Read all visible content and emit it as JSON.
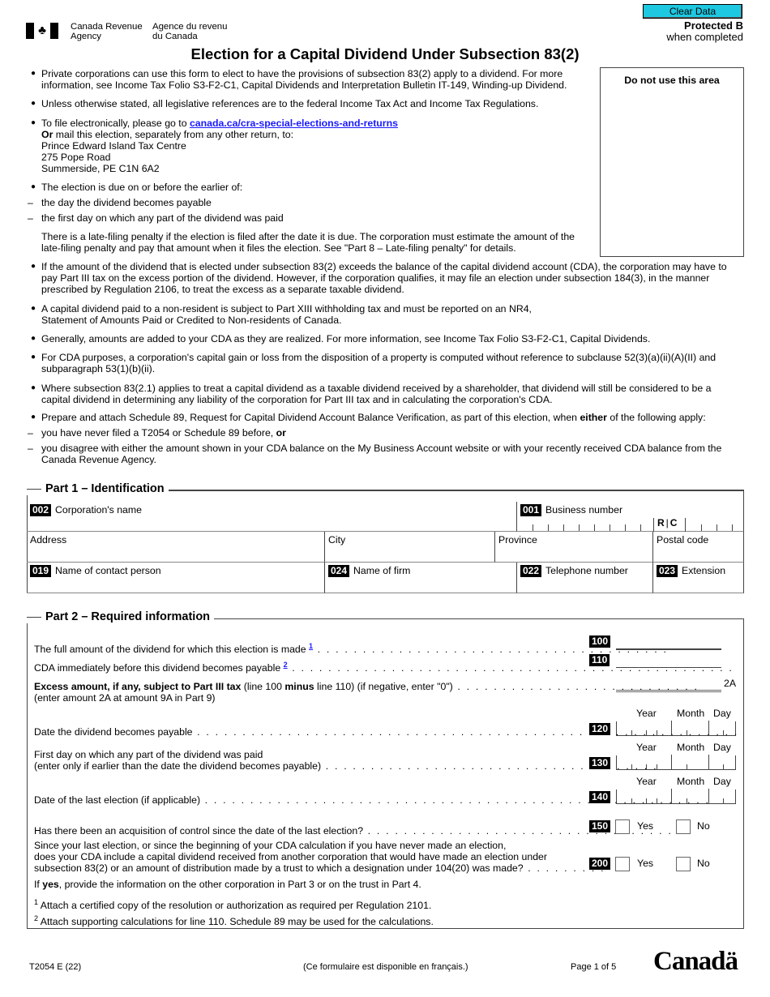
{
  "header": {
    "agency_en_line1": "Canada Revenue",
    "agency_en_line2": "Agency",
    "agency_fr_line1": "Agence du revenu",
    "agency_fr_line2": "du Canada",
    "clear_button": "Clear Data",
    "protected": "Protected B",
    "protected_sub": "when completed",
    "title": "Election for a Capital Dividend Under Subsection 83(2)",
    "do_not_use": "Do not use this area"
  },
  "colors": {
    "clear_button": "#1fc8e1",
    "link": "#1a1aff"
  },
  "intro": {
    "b1_l1": "Private corporations can use this form to elect to have the provisions of subsection 83(2) apply to a dividend. For more",
    "b1_l2": "information, see Income Tax Folio S3-F2-C1, Capital Dividends and Interpretation Bulletin IT-149, Winding-up Dividend.",
    "b2": "Unless otherwise stated, all legislative references are to the federal Income Tax Act and Income Tax Regulations.",
    "b3_prefix": "To file electronically, please go to ",
    "b3_link": "canada.ca/cra-special-elections-and-returns",
    "b3_or": "Or",
    "b3_l2": " mail this election, separately from any other return, to:",
    "addr1": "Prince Edward Island Tax Centre",
    "addr2": "275 Pope Road",
    "addr3": "Summerside, PE  C1N 6A2",
    "b4": "The election is due on or before the earlier of:",
    "b4_d1": "the day the dividend becomes payable",
    "b4_d2": "the first day on which any part of the dividend was paid",
    "b4_p1": "There is a late-filing penalty if the election is filed after the date it is due. The corporation must estimate the amount of the",
    "b4_p2": "late-filing penalty and pay that amount when it files the election. See \"Part 8 – Late-filing penalty\" for details.",
    "b5_l1": "If the amount of the dividend that is elected under subsection 83(2) exceeds the balance of the capital dividend account (CDA), the corporation may have to",
    "b5_l2": "pay Part III tax on the excess portion of the dividend. However, if the corporation qualifies, it may file an election under subsection 184(3), in the manner",
    "b5_l3": "prescribed by Regulation 2106, to treat the excess as a separate taxable dividend.",
    "b6_l1": "A capital dividend paid to a non-resident is subject to Part XIII withholding tax and must be reported on an NR4,",
    "b6_l2": "Statement of Amounts Paid or Credited to Non-residents of Canada.",
    "b7": "Generally, amounts are added to your CDA as they are realized. For more information, see Income Tax Folio S3-F2-C1, Capital Dividends.",
    "b8_l1": "For CDA purposes, a corporation's capital gain or loss from the disposition of a property is computed without reference to subclause 52(3)(a)(ii)(A)(II) and",
    "b8_l2": "subparagraph 53(1)(b)(ii).",
    "b9_l1": "Where subsection 83(2.1) applies to treat a capital dividend as a taxable dividend received by a shareholder, that dividend will still be considered to be a",
    "b9_l2": "capital dividend in determining any liability of the corporation for Part III tax and in calculating the corporation's CDA.",
    "b10_a": "Prepare and attach Schedule 89, Request for Capital Dividend Account Balance Verification, as part of this election, when ",
    "b10_bold": "either",
    "b10_b": " of the following apply:",
    "b10_d1": "you have never filed a T2054 or Schedule 89 before, ",
    "b10_d1_bold": "or",
    "b10_d2_l1": "you disagree with either the amount shown in your CDA balance on the My Business Account website or with your recently received CDA balance from the",
    "b10_d2_l2": "Canada Revenue Agency."
  },
  "part1": {
    "title": "Part 1 – Identification",
    "corp_code": "002",
    "corp_label": "Corporation's name",
    "bn_code": "001",
    "bn_label": "Business number",
    "rc": "R",
    "rc2": "C",
    "address": "Address",
    "city": "City",
    "province": "Province",
    "postal": "Postal code",
    "contact_code": "019",
    "contact_label": "Name of contact person",
    "firm_code": "024",
    "firm_label": "Name of firm",
    "tel_code": "022",
    "tel_label": "Telephone number",
    "ext_code": "023",
    "ext_label": "Extension"
  },
  "part2": {
    "title": "Part 2 – Required information",
    "l100": "The full amount of the dividend for which this election is made ",
    "fn1": "1",
    "c100": "100",
    "l110": "CDA immediately before this dividend becomes payable ",
    "fn2": "2",
    "c110": "110",
    "l2a_bold": "Excess amount, if any, subject to Part III tax",
    "l2a_a": " (line 100 ",
    "l2a_minus": "minus",
    "l2a_b": " line 110) (if negative, enter \"0\")",
    "l2a_l2": "(enter amount 2A at amount 9A in Part 9)",
    "tag2a": "2A",
    "year": "Year",
    "month": "Month",
    "day": "Day",
    "l120": "Date the dividend becomes payable",
    "c120": "120",
    "l130_l1": "First day on which any part of the dividend was paid",
    "l130_l2": "(enter only if earlier than the date the dividend becomes payable)",
    "c130": "130",
    "l140": "Date of the last election (if applicable)",
    "c140": "140",
    "l150": "Has there been an acquisition of control since the date of the last election?",
    "c150": "150",
    "l200_l1": "Since your last election, or since the beginning of your CDA calculation if you have never made an election,",
    "l200_l2": "does your CDA include a capital dividend received from another corporation that would have made an election under",
    "l200_l3": "subsection 83(2) or an amount of distribution made by a trust to which a designation under 104(20) was made?",
    "c200": "200",
    "yes": "Yes",
    "no": "No",
    "ifyes_bold": "yes",
    "ifyes_a": "If ",
    "ifyes_b": ", provide the information on the other corporation in Part 3 or on the trust in Part 4.",
    "note1": "Attach a certified copy of the resolution or authorization as required per Regulation 2101.",
    "note2": "Attach supporting calculations for line 110. Schedule 89 may be used for the calculations.",
    "sup1": "1",
    "sup2": "2"
  },
  "footer": {
    "form_id": "T2054 E (22)",
    "french": "(Ce formulaire est disponible en français.)",
    "page": "Page 1 of 5",
    "wordmark": "Canadä"
  }
}
